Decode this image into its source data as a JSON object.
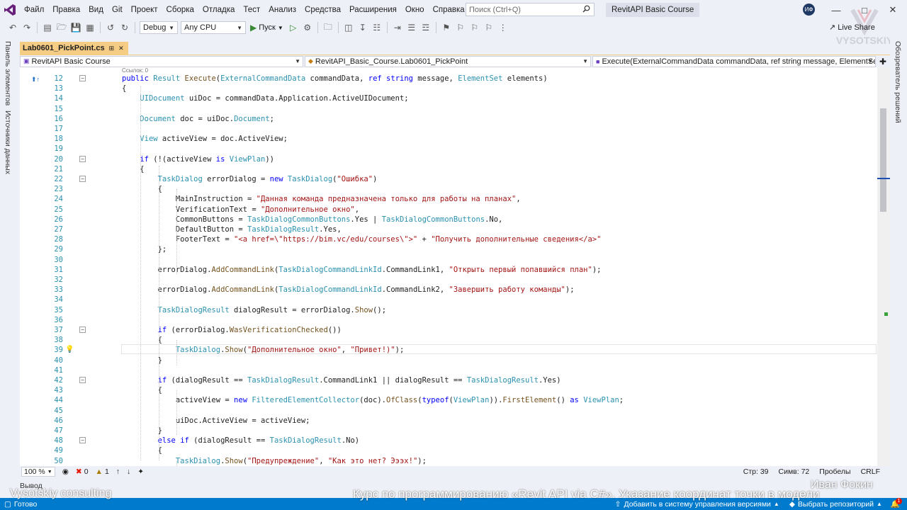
{
  "menu": {
    "items": [
      "Файл",
      "Правка",
      "Вид",
      "Git",
      "Проект",
      "Сборка",
      "Отладка",
      "Тест",
      "Анализ",
      "Средства",
      "Расширения",
      "Окно",
      "Справка"
    ],
    "search_placeholder": "Поиск (Ctrl+Q)",
    "solution_title": "RevitAPI Basic Course",
    "avatar_initials": "ИФ"
  },
  "toolbar": {
    "configuration": "Debug",
    "platform": "Any CPU",
    "run_label": "Пуск",
    "live_share": "Live Share"
  },
  "side_panels": {
    "left_1": "Панель элементов",
    "left_2": "Источники данных",
    "right_1": "Обозреватель решений"
  },
  "tab": {
    "filename": "Lab0601_PickPoint.cs",
    "pin_icon": "pin-icon",
    "close_icon": "close-icon"
  },
  "navbar": {
    "project": "RevitAPI Basic Course",
    "class": "RevitAPI_Basic_Course.Lab0601_PickPoint",
    "member": "Execute(ExternalCommandData commandData, ref string message, ElementSet elem"
  },
  "editor": {
    "refs_hint": "Ссылок: 0",
    "lines": [
      {
        "n": "12",
        "t": "public Result Execute(ExternalCommandData commandData, ref string message, ElementSet elements)"
      },
      {
        "n": "13",
        "t": "{"
      },
      {
        "n": "14",
        "t": "    UIDocument uiDoc = commandData.Application.ActiveUIDocument;"
      },
      {
        "n": "15",
        "t": ""
      },
      {
        "n": "16",
        "t": "    Document doc = uiDoc.Document;"
      },
      {
        "n": "17",
        "t": ""
      },
      {
        "n": "18",
        "t": "    View activeView = doc.ActiveView;"
      },
      {
        "n": "19",
        "t": ""
      },
      {
        "n": "20",
        "t": "    if (!(activeView is ViewPlan))"
      },
      {
        "n": "21",
        "t": "    {"
      },
      {
        "n": "22",
        "t": "        TaskDialog errorDialog = new TaskDialog(\"Ошибка\")"
      },
      {
        "n": "23",
        "t": "        {"
      },
      {
        "n": "24",
        "t": "            MainInstruction = \"Данная команда предназначена только для работы на планах\","
      },
      {
        "n": "25",
        "t": "            VerificationText = \"Дополнительное окно\","
      },
      {
        "n": "26",
        "t": "            CommonButtons = TaskDialogCommonButtons.Yes | TaskDialogCommonButtons.No,"
      },
      {
        "n": "27",
        "t": "            DefaultButton = TaskDialogResult.Yes,"
      },
      {
        "n": "28",
        "t": "            FooterText = \"<a href=\\\"https://bim.vc/edu/courses\\\">\" + \"Получить дополнительные сведения</a>\""
      },
      {
        "n": "29",
        "t": "        };"
      },
      {
        "n": "30",
        "t": ""
      },
      {
        "n": "31",
        "t": "        errorDialog.AddCommandLink(TaskDialogCommandLinkId.CommandLink1, \"Открыть первый попавшийся план\");"
      },
      {
        "n": "32",
        "t": ""
      },
      {
        "n": "33",
        "t": "        errorDialog.AddCommandLink(TaskDialogCommandLinkId.CommandLink2, \"Завершить работу команды\");"
      },
      {
        "n": "34",
        "t": ""
      },
      {
        "n": "35",
        "t": "        TaskDialogResult dialogResult = errorDialog.Show();"
      },
      {
        "n": "36",
        "t": ""
      },
      {
        "n": "37",
        "t": "        if (errorDialog.WasVerificationChecked())"
      },
      {
        "n": "38",
        "t": "        {"
      },
      {
        "n": "39",
        "t": "            TaskDialog.Show(\"Дополнительное окно\", \"Привет!)\");"
      },
      {
        "n": "40",
        "t": "        }"
      },
      {
        "n": "41",
        "t": ""
      },
      {
        "n": "42",
        "t": "        if (dialogResult == TaskDialogResult.CommandLink1 || dialogResult == TaskDialogResult.Yes)"
      },
      {
        "n": "43",
        "t": "        {"
      },
      {
        "n": "44",
        "t": "            activeView = new FilteredElementCollector(doc).OfClass(typeof(ViewPlan)).FirstElement() as ViewPlan;"
      },
      {
        "n": "45",
        "t": ""
      },
      {
        "n": "46",
        "t": "            uiDoc.ActiveView = activeView;"
      },
      {
        "n": "47",
        "t": "        }"
      },
      {
        "n": "48",
        "t": "        else if (dialogResult == TaskDialogResult.No)"
      },
      {
        "n": "49",
        "t": "        {"
      },
      {
        "n": "50",
        "t": "            TaskDialog.Show(\"Предупреждение\", \"Как это нет? Эээх!\");"
      }
    ]
  },
  "editor_status": {
    "zoom": "100 %",
    "errors": "0",
    "warnings": "1",
    "line": "Стр: 39",
    "col": "Симв: 72",
    "spaces": "Пробелы",
    "eol": "CRLF"
  },
  "output": {
    "label": "Вывод"
  },
  "statusbar": {
    "ready": "Готово",
    "add_to_vcs": "Добавить в систему управления версиями",
    "select_repo": "Выбрать репозиторий",
    "notifications": "1"
  },
  "watermark": {
    "company": "Vysotskiy consulting",
    "author": "Иван Фокин",
    "course": "Курс по программированию «Revit API via C#». Указание координат точки в модели",
    "brand": "VYSOTSKIY"
  },
  "colors": {
    "tab_accent": "#f5cc84",
    "status_bar": "#007acc",
    "keyword": "#0000ff",
    "type": "#2b91af",
    "string": "#a31515"
  }
}
